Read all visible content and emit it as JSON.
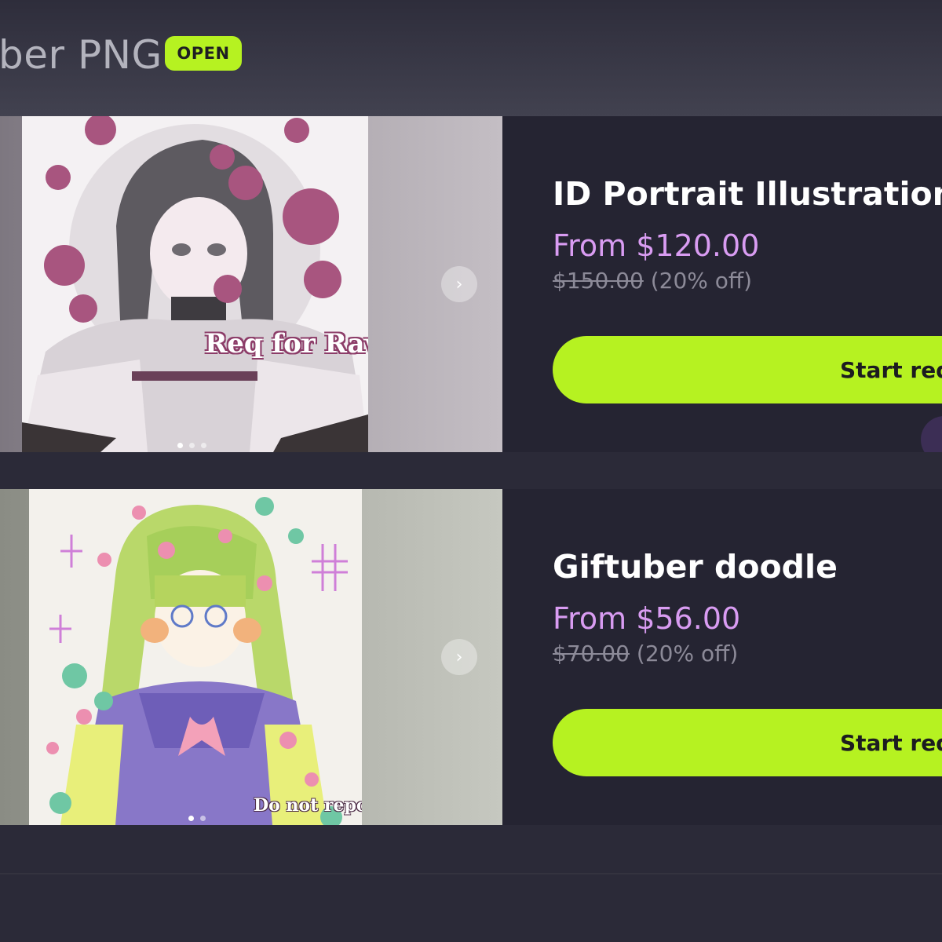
{
  "header": {
    "title": "ber PNG",
    "status_badge": "OPEN"
  },
  "listings": [
    {
      "title": "ID Portrait Illustration",
      "price": "From $120.00",
      "old_price": "$150.00",
      "discount": "(20% off)",
      "cta_label": "Start req",
      "watermark": "Req for Raw",
      "next_icon": "chevron-right-icon",
      "gallery_dots": 3,
      "active_dot": 1
    },
    {
      "title": "Giftuber doodle",
      "price": "From $56.00",
      "old_price": "$70.00",
      "discount": "(20% off)",
      "cta_label": "Start req",
      "watermark": "Do not repost",
      "next_icon": "chevron-right-icon",
      "gallery_dots": 2,
      "active_dot": 1
    }
  ],
  "colors": {
    "accent": "#b6f221",
    "price": "#d99cf2",
    "background": "#2b2a38",
    "card": "#252432"
  }
}
